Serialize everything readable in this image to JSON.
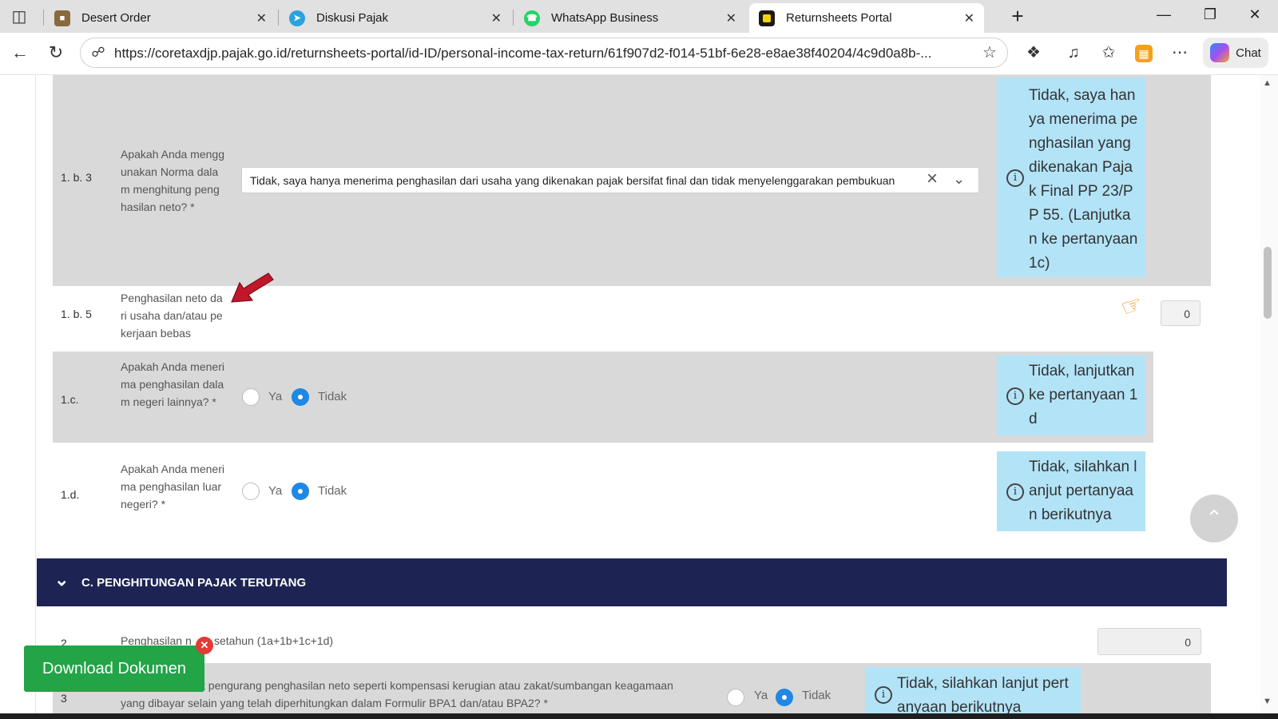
{
  "browser": {
    "tabs": [
      {
        "title": "Desert Order",
        "icon": "game-icon",
        "active": false
      },
      {
        "title": "Diskusi Pajak",
        "icon": "telegram-icon",
        "active": false
      },
      {
        "title": "WhatsApp Business",
        "icon": "whatsapp-icon",
        "active": false
      },
      {
        "title": "Returnsheets Portal",
        "icon": "portal-icon",
        "active": true
      }
    ],
    "url": "https://coretaxdjp.pajak.go.id/returnsheets-portal/id-ID/personal-income-tax-return/61f907d2-f014-51bf-6e28-e8ae38f40204/4c9d0a8b-...",
    "chat_label": "Chat"
  },
  "form": {
    "q_1b3": {
      "number": "1. b. 3",
      "question": "Apakah Anda menggunakan Norma dalam menghitung penghasilan neto? *",
      "selected_value": "Tidak, saya hanya menerima penghasilan dari usaha yang dikenakan pajak bersifat final dan tidak menyelenggarakan pembukuan",
      "info": "Tidak, saya hanya menerima penghasilan yang dikenakan Pajak Final PP 23/PP 55. (Lanjutkan ke pertanyaan 1c)"
    },
    "q_1b5": {
      "number": "1. b. 5",
      "question": "Penghasilan neto dari usaha dan/atau pekerjaan bebas",
      "value": "0"
    },
    "q_1c": {
      "number": "1.c.",
      "question": "Apakah Anda menerima penghasilan dalam negeri lainnya? *",
      "yes_label": "Ya",
      "no_label": "Tidak",
      "selected": "Tidak",
      "info": "Tidak, lanjutkan ke pertanyaan 1d"
    },
    "q_1d": {
      "number": "1.d.",
      "question": "Apakah Anda menerima penghasilan luar negeri? *",
      "yes_label": "Ya",
      "no_label": "Tidak",
      "selected": "Tidak",
      "info": "Tidak, silahkan lanjut pertanyaan berikutnya"
    },
    "section_c_title": "C. PENGHITUNGAN PAJAK TERUTANG",
    "q_2": {
      "number": "2",
      "question_part1": "Penghasilan n",
      "question_part2": "setahun (1a+1b+1c+1d)",
      "value": "0"
    },
    "q_3": {
      "number": "3",
      "question_line1": "t pengurang penghasilan neto seperti kompensasi kerugian atau zakat/sumbangan keagamaan",
      "question_line2": "yang dibayar selain yang telah diperhitungkan dalam Formulir BPA1 dan/atau BPA2? *",
      "yes_label": "Ya",
      "no_label": "Tidak",
      "selected": "Tidak",
      "info": "Tidak, silahkan lanjut pertanyaan berikutnya"
    }
  },
  "download_button": "Download Dokumen"
}
